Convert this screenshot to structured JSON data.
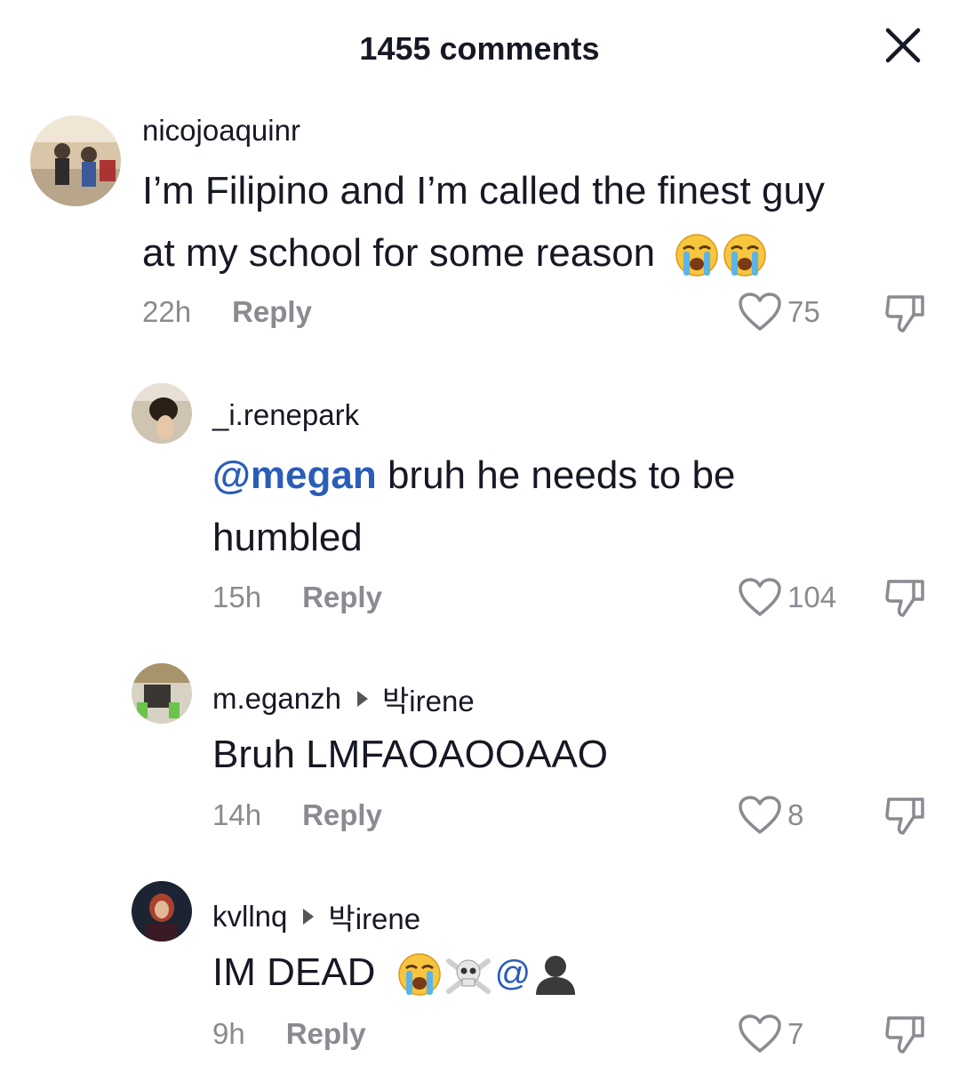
{
  "header": {
    "title": "1455 comments"
  },
  "comments": [
    {
      "username": "nicojoaquinr",
      "text_line1": "I’m Filipino and I’m called the finest guy",
      "text_line2": "at my school for some reason",
      "emojis": [
        "loudly-crying-face",
        "loudly-crying-face"
      ],
      "time": "22h",
      "reply_label": "Reply",
      "likes": "75"
    },
    {
      "username": "_i.renepark",
      "mention": "@megan",
      "text_line1": " bruh he needs to be",
      "text_line2": "humbled",
      "time": "15h",
      "reply_label": "Reply",
      "likes": "104"
    },
    {
      "username": "m.eganzh",
      "reply_to": "박irene",
      "text_line1": "Bruh LMFAOAOOAAO",
      "time": "14h",
      "reply_label": "Reply",
      "likes": "8"
    },
    {
      "username": "kvllnq",
      "reply_to": "박irene",
      "text_line1": "IM DEAD",
      "emojis": [
        "loudly-crying-face",
        "skull-and-crossbones",
        "at-sign",
        "bust-in-silhouette"
      ],
      "at_symbol": "@",
      "time": "9h",
      "reply_label": "Reply",
      "likes": "7"
    }
  ],
  "colors": {
    "mention": "#2b5db8",
    "muted": "#8a8b91",
    "text": "#161823"
  }
}
